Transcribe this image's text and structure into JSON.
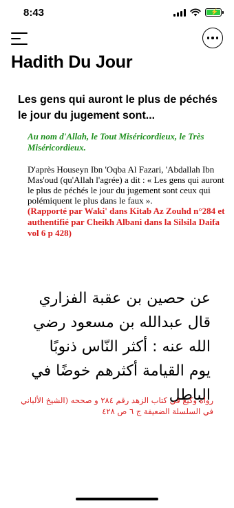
{
  "status_bar": {
    "time": "8:43",
    "battery_charging": true,
    "battery_color": "#2ecc40"
  },
  "nav": {
    "menu_icon": "hamburger-menu-icon",
    "more_icon": "ellipsis-circle-icon"
  },
  "page": {
    "title": "Hadith Du Jour"
  },
  "hadith": {
    "title": "Les gens qui auront le plus de péchés le jour du jugement sont...",
    "bismillah": "Au nom d'Allah, le Tout Miséricordieux, le Très Miséricordieux.",
    "narration": "D'après Houseyn Ibn 'Oqba Al Fazari, 'Abdallah Ibn Mas'oud (qu'Allah l'agrée) a dit : « Les gens qui auront le plus de péchés le jour du jugement sont ceux qui polémiquent le plus dans le faux ».",
    "reference": "(Rapporté par Waki' dans Kitab Az Zouhd n°284 et authentifié par Cheikh Albani dans la Silsila Daifa vol 6 p 428)",
    "arabic_text": "عن حصين بن عقبة الفزاري قال عبدالله بن مسعود رضي الله عنه : أكثر النّاس ذنوبًا يوم القيامة أكثرهم خوضًا في الباطل",
    "arabic_reference": "رواه وكيع في كتاب الزهد رقم ٢٨٤ و صححه (الشيخ الألباني في السلسلة الضعيفة ج ٦ ص ٤٢٨",
    "colors": {
      "bismillah": "#1e8f1e",
      "reference": "#d91e1e"
    }
  }
}
